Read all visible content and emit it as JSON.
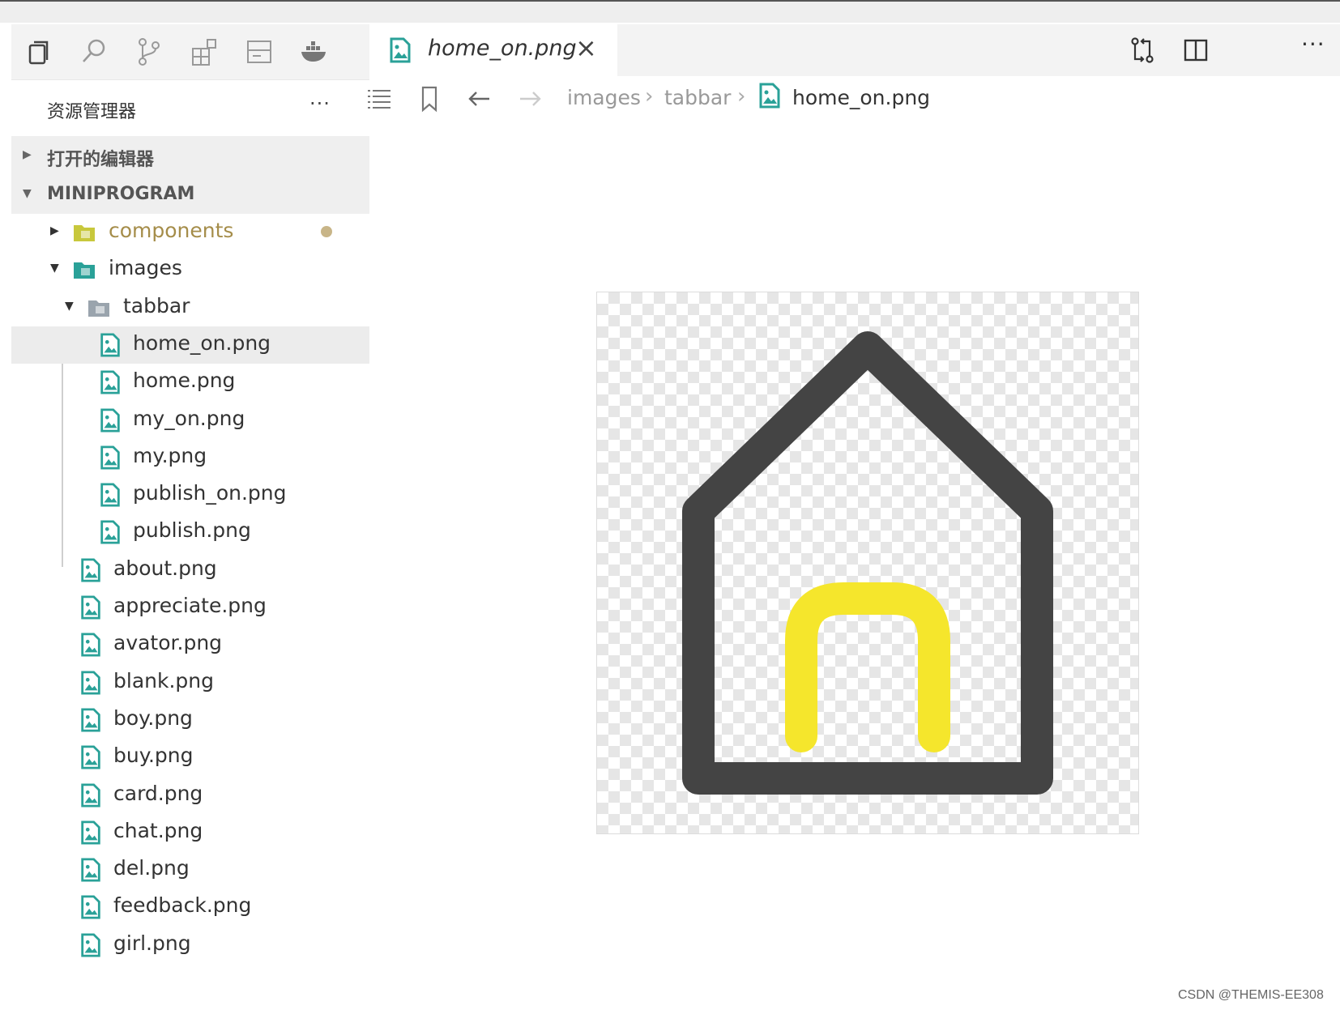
{
  "sidebar": {
    "explorer_title": "资源管理器",
    "more": "···",
    "open_editors": "打开的编辑器",
    "project": "MINIPROGRAM",
    "tree": [
      {
        "label": "components",
        "kind": "folder-components",
        "depth": 1,
        "expanded": false,
        "modified": true
      },
      {
        "label": "images",
        "kind": "folder-images",
        "depth": 1,
        "expanded": true
      },
      {
        "label": "tabbar",
        "kind": "folder",
        "depth": 2,
        "expanded": true
      },
      {
        "label": "home_on.png",
        "kind": "image-file",
        "depth": 3,
        "selected": true
      },
      {
        "label": "home.png",
        "kind": "image-file",
        "depth": 3
      },
      {
        "label": "my_on.png",
        "kind": "image-file",
        "depth": 3
      },
      {
        "label": "my.png",
        "kind": "image-file",
        "depth": 3
      },
      {
        "label": "publish_on.png",
        "kind": "image-file",
        "depth": 3
      },
      {
        "label": "publish.png",
        "kind": "image-file",
        "depth": 3
      },
      {
        "label": "about.png",
        "kind": "image-file",
        "depth": 2
      },
      {
        "label": "appreciate.png",
        "kind": "image-file",
        "depth": 2
      },
      {
        "label": "avator.png",
        "kind": "image-file",
        "depth": 2
      },
      {
        "label": "blank.png",
        "kind": "image-file",
        "depth": 2
      },
      {
        "label": "boy.png",
        "kind": "image-file",
        "depth": 2
      },
      {
        "label": "buy.png",
        "kind": "image-file",
        "depth": 2
      },
      {
        "label": "card.png",
        "kind": "image-file",
        "depth": 2
      },
      {
        "label": "chat.png",
        "kind": "image-file",
        "depth": 2
      },
      {
        "label": "del.png",
        "kind": "image-file",
        "depth": 2
      },
      {
        "label": "feedback.png",
        "kind": "image-file",
        "depth": 2
      },
      {
        "label": "girl.png",
        "kind": "image-file",
        "depth": 2
      }
    ]
  },
  "activity_icons": [
    "explorer-icon",
    "search-icon",
    "source-control-icon",
    "extensions-icon",
    "outline-icon",
    "docker-icon"
  ],
  "editor": {
    "tab_label": "home_on.png",
    "tab_close": "×",
    "more": "···",
    "breadcrumb": [
      "images",
      "tabbar",
      "home_on.png"
    ],
    "breadcrumb_sep": "›"
  },
  "preview": {
    "house_color": "#444444",
    "door_color": "#f5e62c"
  },
  "colors": {
    "file_icon": "#2aa198",
    "components_folder": "#c8c83c",
    "images_folder": "#2aa198",
    "modified_dot": "#c8b588"
  },
  "watermark": "CSDN @THEMIS-EE308"
}
